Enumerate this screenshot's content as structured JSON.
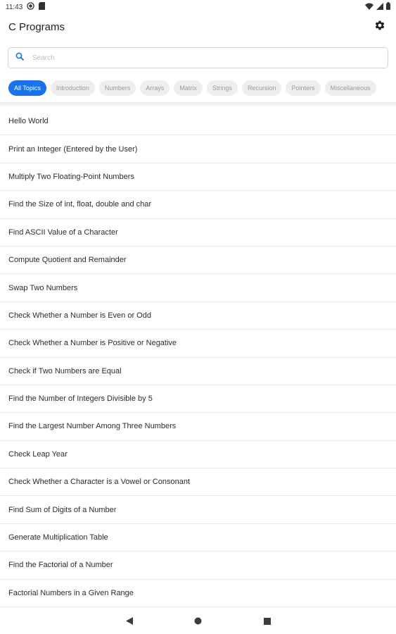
{
  "status_bar": {
    "time": "11:43"
  },
  "header": {
    "title": "C Programs",
    "settings_icon": "gear-icon"
  },
  "search": {
    "placeholder": "Search",
    "value": ""
  },
  "chips": [
    {
      "label": "All Topics",
      "active": true
    },
    {
      "label": "Introduction",
      "active": false
    },
    {
      "label": "Numbers",
      "active": false
    },
    {
      "label": "Arrays",
      "active": false
    },
    {
      "label": "Matrix",
      "active": false
    },
    {
      "label": "Strings",
      "active": false
    },
    {
      "label": "Recursion",
      "active": false
    },
    {
      "label": "Pointers",
      "active": false
    },
    {
      "label": "Miscellaneous",
      "active": false
    }
  ],
  "programs": [
    "Hello World",
    "Print an Integer (Entered by the User)",
    "Multiply Two Floating-Point Numbers",
    "Find the Size of int, float, double and char",
    "Find ASCII Value of a Character",
    "Compute Quotient and Remainder",
    "Swap Two Numbers",
    "Check Whether a Number is Even or Odd",
    "Check Whether a Number is Positive or Negative",
    "Check if Two Numbers are Equal",
    "Find the Number of Integers Divisible by 5",
    "Find the Largest Number Among Three Numbers",
    "Check Leap Year",
    "Check Whether a Character is a Vowel or Consonant",
    "Find Sum of Digits of a Number",
    "Generate Multiplication Table",
    "Find the Factorial of a Number",
    "Factorial Numbers in a Given Range"
  ],
  "colors": {
    "accent": "#1a73e8",
    "chip_bg": "#eeeeee",
    "chip_text": "#9a9a9a"
  }
}
